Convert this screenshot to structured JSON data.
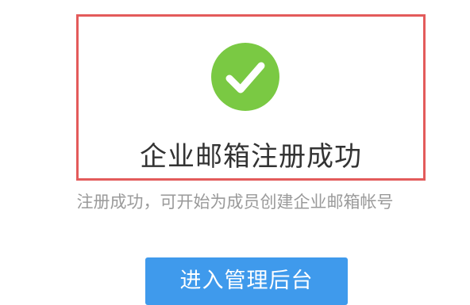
{
  "success": {
    "icon": "check-circle-icon",
    "icon_color": "#7ac943",
    "title": "企业邮箱注册成功",
    "subtitle": "注册成功，可开始为成员创建企业邮箱帐号"
  },
  "actions": {
    "enter_admin_label": "进入管理后台",
    "button_color": "#3f9aec"
  },
  "highlight": {
    "border_color": "#e35b5b"
  }
}
